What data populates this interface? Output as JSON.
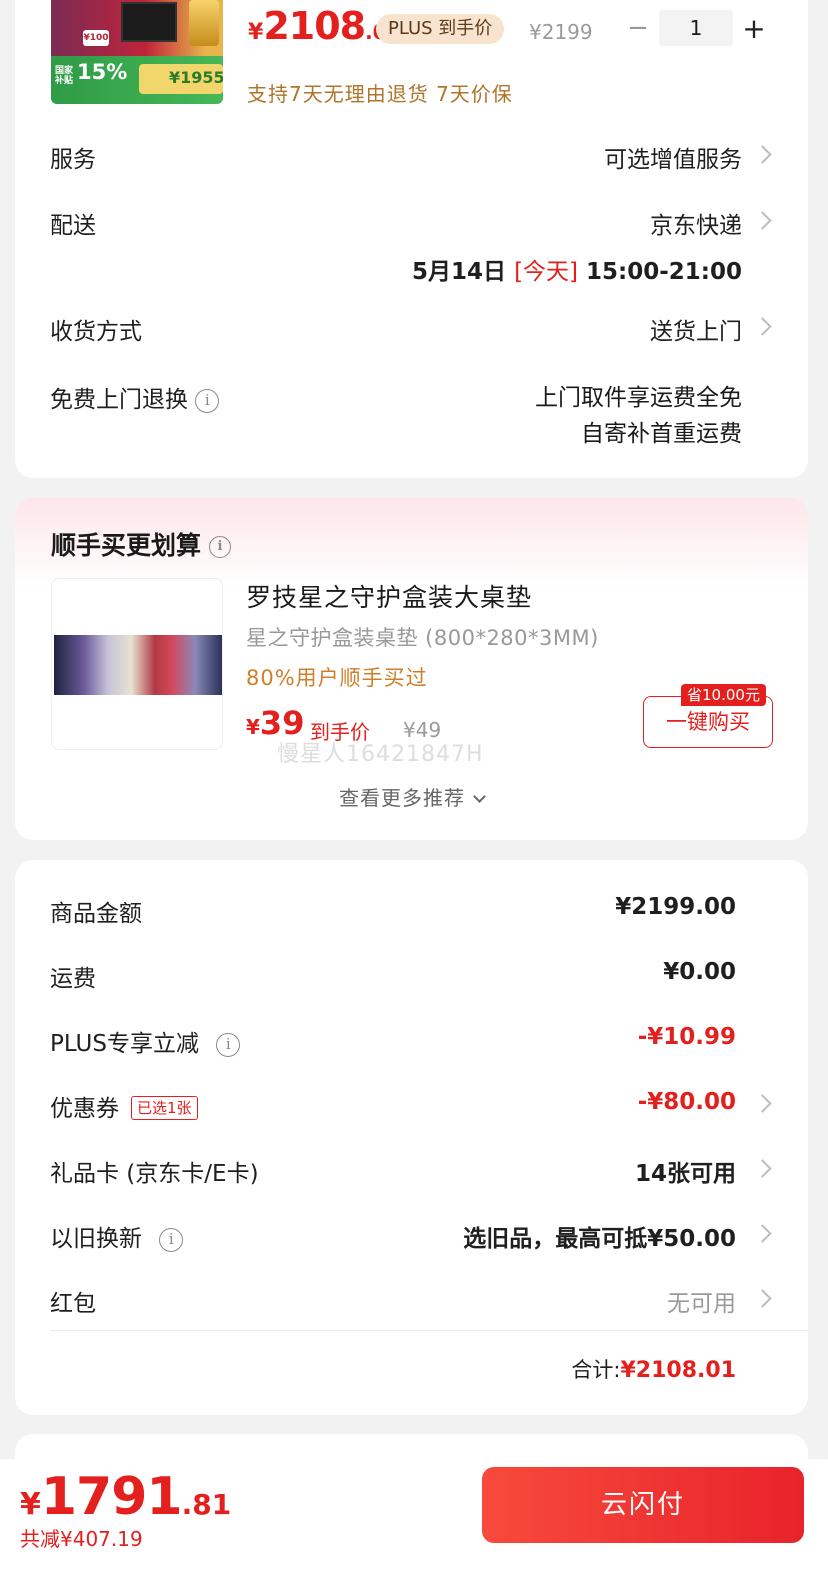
{
  "product": {
    "thumb_text": {
      "b100": "¥100",
      "national": "国家补贴",
      "discount": "15%",
      "subsidy_amount": "¥1955"
    },
    "price_yen": "¥",
    "price_int": "2108",
    "price_dec": ".01",
    "plus_badge": "PLUS 到手价",
    "original_price": "¥2199",
    "qty_minus": "−",
    "quantity": "1",
    "qty_plus": "+",
    "service_tags": "支持7天无理由退货  7天价保"
  },
  "details": {
    "service": {
      "label": "服务",
      "value": "可选增值服务"
    },
    "delivery": {
      "label": "配送",
      "value": "京东快递",
      "date": "5月14日",
      "today": "[今天]",
      "window": "15:00-21:00"
    },
    "receive": {
      "label": "收货方式",
      "value": "送货上门"
    },
    "free_return": {
      "label": "免费上门退换",
      "line1": "上门取件享运费全免",
      "line2": "自寄补首重运费"
    }
  },
  "addon": {
    "title": "顺手买更划算",
    "name": "罗技星之守护盒装大桌垫",
    "spec": "星之守护盒装桌垫 (800*280*3MM)",
    "popular": "80%用户顺手买过",
    "price_yen": "¥",
    "price_int": "39",
    "price_label": "到手价",
    "original_price": "¥49",
    "save_badge": "省10.00元",
    "buy_button": "一键购买",
    "watermark": "慢星人16421847H",
    "more": "查看更多推荐"
  },
  "summary": {
    "goods_amount": {
      "label": "商品金额",
      "value": "¥2199.00"
    },
    "shipping": {
      "label": "运费",
      "value": "¥0.00"
    },
    "plus_discount": {
      "label": "PLUS专享立减",
      "value": "-¥10.99"
    },
    "coupon": {
      "label": "优惠券",
      "tag": "已选1张",
      "value": "-¥80.00"
    },
    "gift_card": {
      "label": "礼品卡 (京东卡/E卡)",
      "value": "14张可用"
    },
    "trade_in": {
      "label": "以旧换新",
      "value": "选旧品，最高可抵¥50.00"
    },
    "red_packet": {
      "label": "红包",
      "value": "无可用"
    },
    "total_label": "合计:",
    "total_value": "¥2108.01"
  },
  "footer": {
    "final_yen": "¥",
    "final_int": "1791",
    "final_dec": ".81",
    "total_saved": "共减¥407.19",
    "pay_button": "云闪付"
  },
  "colors": {
    "accent": "#e3201e",
    "plus_badge_bg": "#f8e3cf",
    "tag_orange": "#b0742a"
  }
}
